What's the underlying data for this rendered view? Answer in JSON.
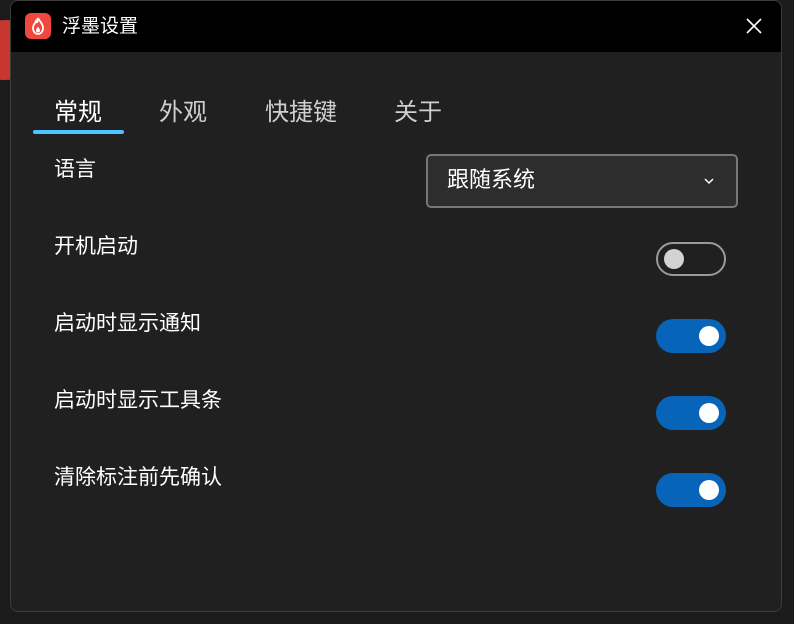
{
  "window": {
    "title": "浮墨设置",
    "app_icon": "flame-icon",
    "close_icon": "close-icon"
  },
  "tabs": [
    {
      "label": "常规",
      "active": true
    },
    {
      "label": "外观",
      "active": false
    },
    {
      "label": "快捷键",
      "active": false
    },
    {
      "label": "关于",
      "active": false
    }
  ],
  "settings": {
    "language": {
      "label": "语言",
      "value": "跟随系统",
      "icon": "chevron-down-icon"
    },
    "launch_at_startup": {
      "label": "开机启动",
      "enabled": false
    },
    "show_notification_on_start": {
      "label": "启动时显示通知",
      "enabled": true
    },
    "show_toolbar_on_start": {
      "label": "启动时显示工具条",
      "enabled": true
    },
    "confirm_before_clear": {
      "label": "清除标注前先确认",
      "enabled": true
    }
  },
  "colors": {
    "accent": "#4cc2ff",
    "toggle_on": "#0864b9",
    "app_icon_bg": "#f0483e",
    "titlebar": "#000000",
    "panel": "#202020"
  }
}
